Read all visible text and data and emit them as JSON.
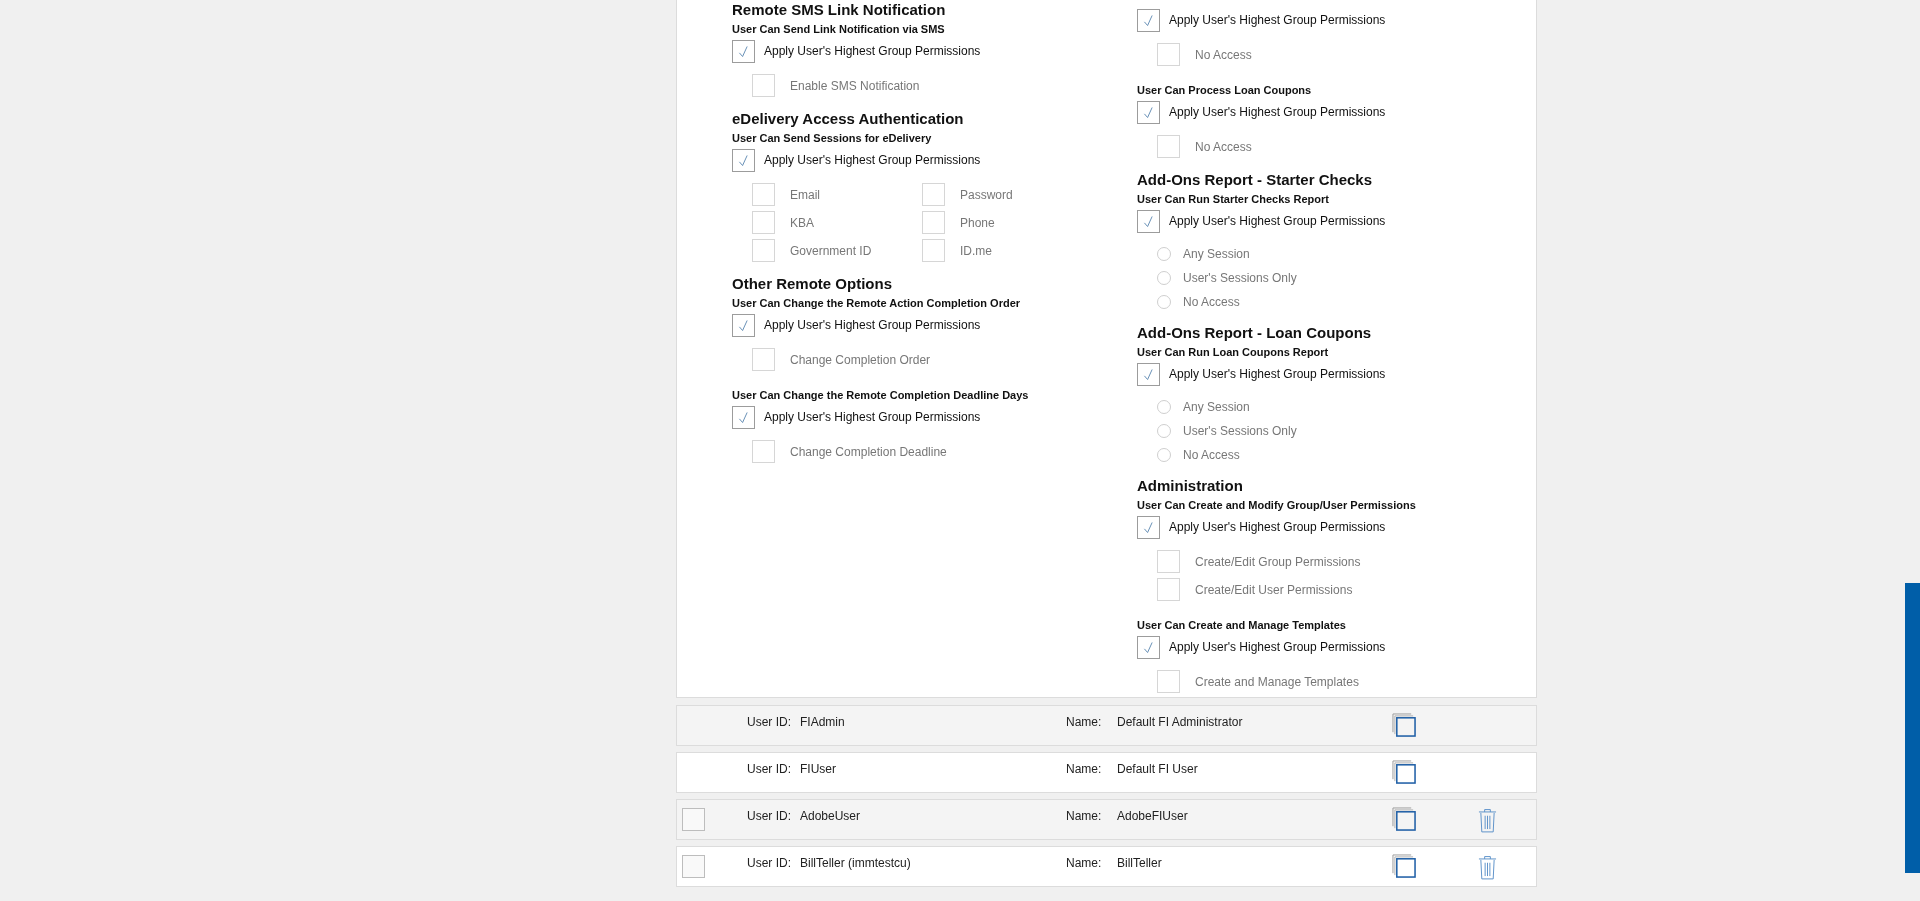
{
  "left_column": {
    "sections": [
      {
        "heading": "Remote SMS Link Notification",
        "questions": [
          {
            "title": "User Can Send Link Notification via SMS",
            "apply": {
              "label": "Apply User's Highest Group Permissions",
              "checked": true
            },
            "option_columns": [
              [
                {
                  "kind": "checkbox",
                  "label": "Enable SMS Notification",
                  "checked": false
                }
              ]
            ]
          }
        ]
      },
      {
        "heading": "eDelivery Access Authentication",
        "questions": [
          {
            "title": "User Can Send Sessions for eDelivery",
            "apply": {
              "label": "Apply User's Highest Group Permissions",
              "checked": true
            },
            "option_columns": [
              [
                {
                  "kind": "checkbox",
                  "label": "Email",
                  "checked": false
                },
                {
                  "kind": "checkbox",
                  "label": "KBA",
                  "checked": false
                },
                {
                  "kind": "checkbox",
                  "label": "Government ID",
                  "checked": false
                }
              ],
              [
                {
                  "kind": "checkbox",
                  "label": "Password",
                  "checked": false
                },
                {
                  "kind": "checkbox",
                  "label": "Phone",
                  "checked": false
                },
                {
                  "kind": "checkbox",
                  "label": "ID.me",
                  "checked": false
                }
              ]
            ]
          }
        ]
      },
      {
        "heading": "Other Remote Options",
        "questions": [
          {
            "title": "User Can Change the Remote Action Completion Order",
            "apply": {
              "label": "Apply User's Highest Group Permissions",
              "checked": true
            },
            "option_columns": [
              [
                {
                  "kind": "checkbox",
                  "label": "Change Completion Order",
                  "checked": false
                }
              ]
            ]
          },
          {
            "title": "User Can Change the Remote Completion Deadline Days",
            "apply": {
              "label": "Apply User's Highest Group Permissions",
              "checked": true
            },
            "option_columns": [
              [
                {
                  "kind": "checkbox",
                  "label": "Change Completion Deadline",
                  "checked": false
                }
              ]
            ]
          }
        ]
      }
    ]
  },
  "right_column": {
    "sections": [
      {
        "questions": [
          {
            "apply": {
              "label": "Apply User's Highest Group Permissions",
              "checked": true
            },
            "option_columns": [
              [
                {
                  "kind": "checkbox",
                  "label": "No Access",
                  "checked": false
                }
              ]
            ]
          },
          {
            "title": "User Can Process Loan Coupons",
            "apply": {
              "label": "Apply User's Highest Group Permissions",
              "checked": true
            },
            "option_columns": [
              [
                {
                  "kind": "checkbox",
                  "label": "No Access",
                  "checked": false
                }
              ]
            ]
          }
        ]
      },
      {
        "heading": "Add-Ons Report - Starter Checks",
        "questions": [
          {
            "title": "User Can Run Starter Checks Report",
            "apply": {
              "label": "Apply User's Highest Group Permissions",
              "checked": true
            },
            "option_columns": [
              [
                {
                  "kind": "radio",
                  "label": "Any Session",
                  "selected": false
                },
                {
                  "kind": "radio",
                  "label": "User's Sessions Only",
                  "selected": false
                },
                {
                  "kind": "radio",
                  "label": "No Access",
                  "selected": false
                }
              ]
            ]
          }
        ]
      },
      {
        "heading": "Add-Ons Report - Loan Coupons",
        "questions": [
          {
            "title": "User Can Run Loan Coupons Report",
            "apply": {
              "label": "Apply User's Highest Group Permissions",
              "checked": true
            },
            "option_columns": [
              [
                {
                  "kind": "radio",
                  "label": "Any Session",
                  "selected": false
                },
                {
                  "kind": "radio",
                  "label": "User's Sessions Only",
                  "selected": false
                },
                {
                  "kind": "radio",
                  "label": "No Access",
                  "selected": false
                }
              ]
            ]
          }
        ]
      },
      {
        "heading": "Administration",
        "questions": [
          {
            "title": "User Can Create and Modify Group/User Permissions",
            "apply": {
              "label": "Apply User's Highest Group Permissions",
              "checked": true
            },
            "option_columns": [
              [
                {
                  "kind": "checkbox",
                  "label": "Create/Edit Group Permissions",
                  "checked": false
                },
                {
                  "kind": "checkbox",
                  "label": "Create/Edit User Permissions",
                  "checked": false
                }
              ]
            ]
          },
          {
            "title": "User Can Create and Manage Templates",
            "apply": {
              "label": "Apply User's Highest Group Permissions",
              "checked": true
            },
            "option_columns": [
              [
                {
                  "kind": "checkbox",
                  "label": "Create and Manage Templates",
                  "checked": false
                }
              ]
            ]
          }
        ]
      }
    ]
  },
  "users": [
    {
      "id_label": "User ID:",
      "user_id": "FIAdmin",
      "name_label": "Name:",
      "name": "Default FI Administrator",
      "deletable": false
    },
    {
      "id_label": "User ID:",
      "user_id": "FIUser",
      "name_label": "Name:",
      "name": "Default FI User",
      "deletable": false
    },
    {
      "id_label": "User ID:",
      "user_id": "AdobeUser",
      "name_label": "Name:",
      "name": "AdobeFIUser",
      "checked": false,
      "deletable": true
    },
    {
      "id_label": "User ID:",
      "user_id": "BillTeller (immtestcu)",
      "name_label": "Name:",
      "name": "BillTeller",
      "checked": false,
      "deletable": true
    }
  ]
}
